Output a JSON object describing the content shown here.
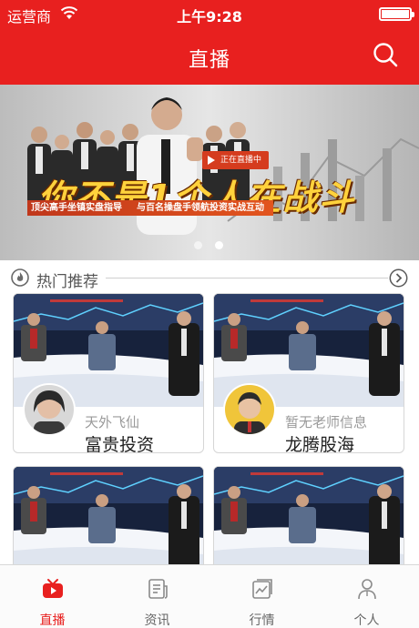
{
  "status_bar": {
    "carrier": "运营商",
    "time": "上午9:28"
  },
  "nav": {
    "title": "直播",
    "search_icon": "search-icon"
  },
  "banner": {
    "live_badge": "正在直播中",
    "slogan": "你不是1个人在战斗",
    "subline_left": "顶尖高手坐镇实盘指导",
    "subline_right": "与百名操盘手领航投资实战互动",
    "page_count": 2,
    "active_page": 2
  },
  "section": {
    "title": "热门推荐",
    "icon": "fire-icon",
    "more_icon": "chevron-right-circle-icon"
  },
  "rooms": [
    {
      "teacher": "天外飞仙",
      "name": "富贵投资"
    },
    {
      "teacher": "暂无老师信息",
      "name": "龙腾股海"
    },
    {
      "teacher": "",
      "name": ""
    },
    {
      "teacher": "",
      "name": ""
    }
  ],
  "tabs": [
    {
      "label": "直播",
      "icon": "tv-icon",
      "active": true
    },
    {
      "label": "资讯",
      "icon": "news-icon",
      "active": false
    },
    {
      "label": "行情",
      "icon": "chart-icon",
      "active": false
    },
    {
      "label": "个人",
      "icon": "person-icon",
      "active": false
    }
  ],
  "colors": {
    "brand_red": "#e8201f",
    "tab_inactive": "#666666"
  }
}
